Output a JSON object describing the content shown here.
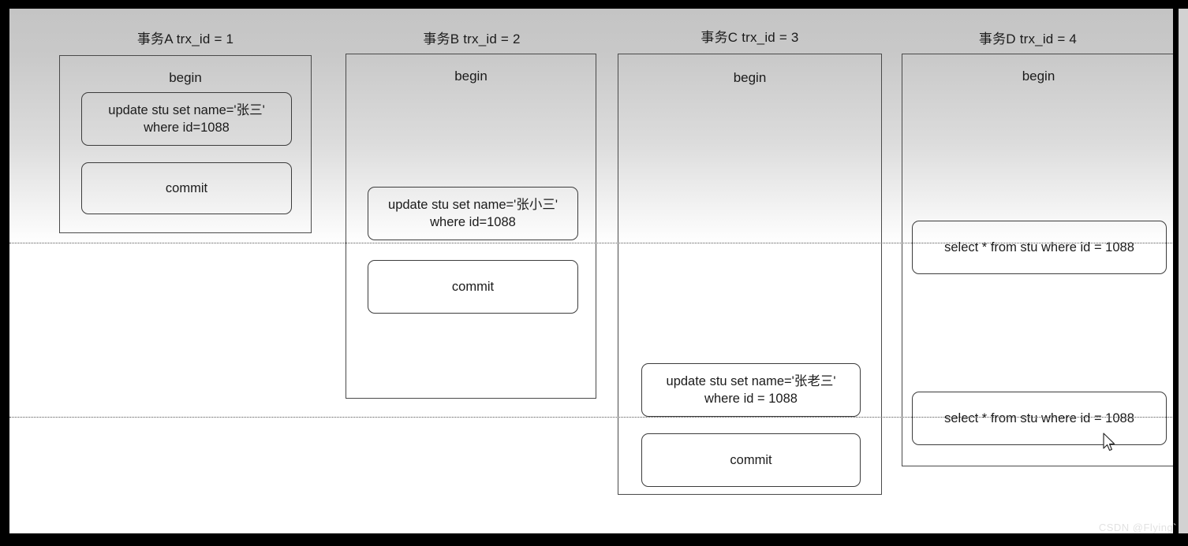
{
  "figure": {
    "title_note": "MVCC transaction timeline diagram",
    "watermark": "CSDN @Flying`"
  },
  "columns": [
    {
      "header": "事务A trx_id = 1",
      "begin_label": "begin",
      "statements": [
        {
          "name": "update-statement",
          "lines": [
            "update stu set name='张三'",
            "where id=1088"
          ]
        },
        {
          "name": "commit-statement",
          "lines": [
            "commit"
          ]
        }
      ]
    },
    {
      "header": "事务B trx_id = 2",
      "begin_label": "begin",
      "statements": [
        {
          "name": "update-statement",
          "lines": [
            "update stu set name='张小三'",
            "where id=1088"
          ]
        },
        {
          "name": "commit-statement",
          "lines": [
            "commit"
          ]
        }
      ]
    },
    {
      "header": "事务C trx_id = 3",
      "begin_label": "begin",
      "statements": [
        {
          "name": "update-statement",
          "lines": [
            "update stu set name='张老三'",
            "where id = 1088"
          ]
        },
        {
          "name": "commit-statement",
          "lines": [
            "commit"
          ]
        }
      ]
    },
    {
      "header": "事务D trx_id = 4",
      "begin_label": "begin",
      "statements": [
        {
          "name": "select-statement",
          "lines": [
            "select * from stu where id = 1088"
          ]
        },
        {
          "name": "select-statement",
          "lines": [
            "select * from stu where id = 1088"
          ]
        }
      ]
    }
  ]
}
